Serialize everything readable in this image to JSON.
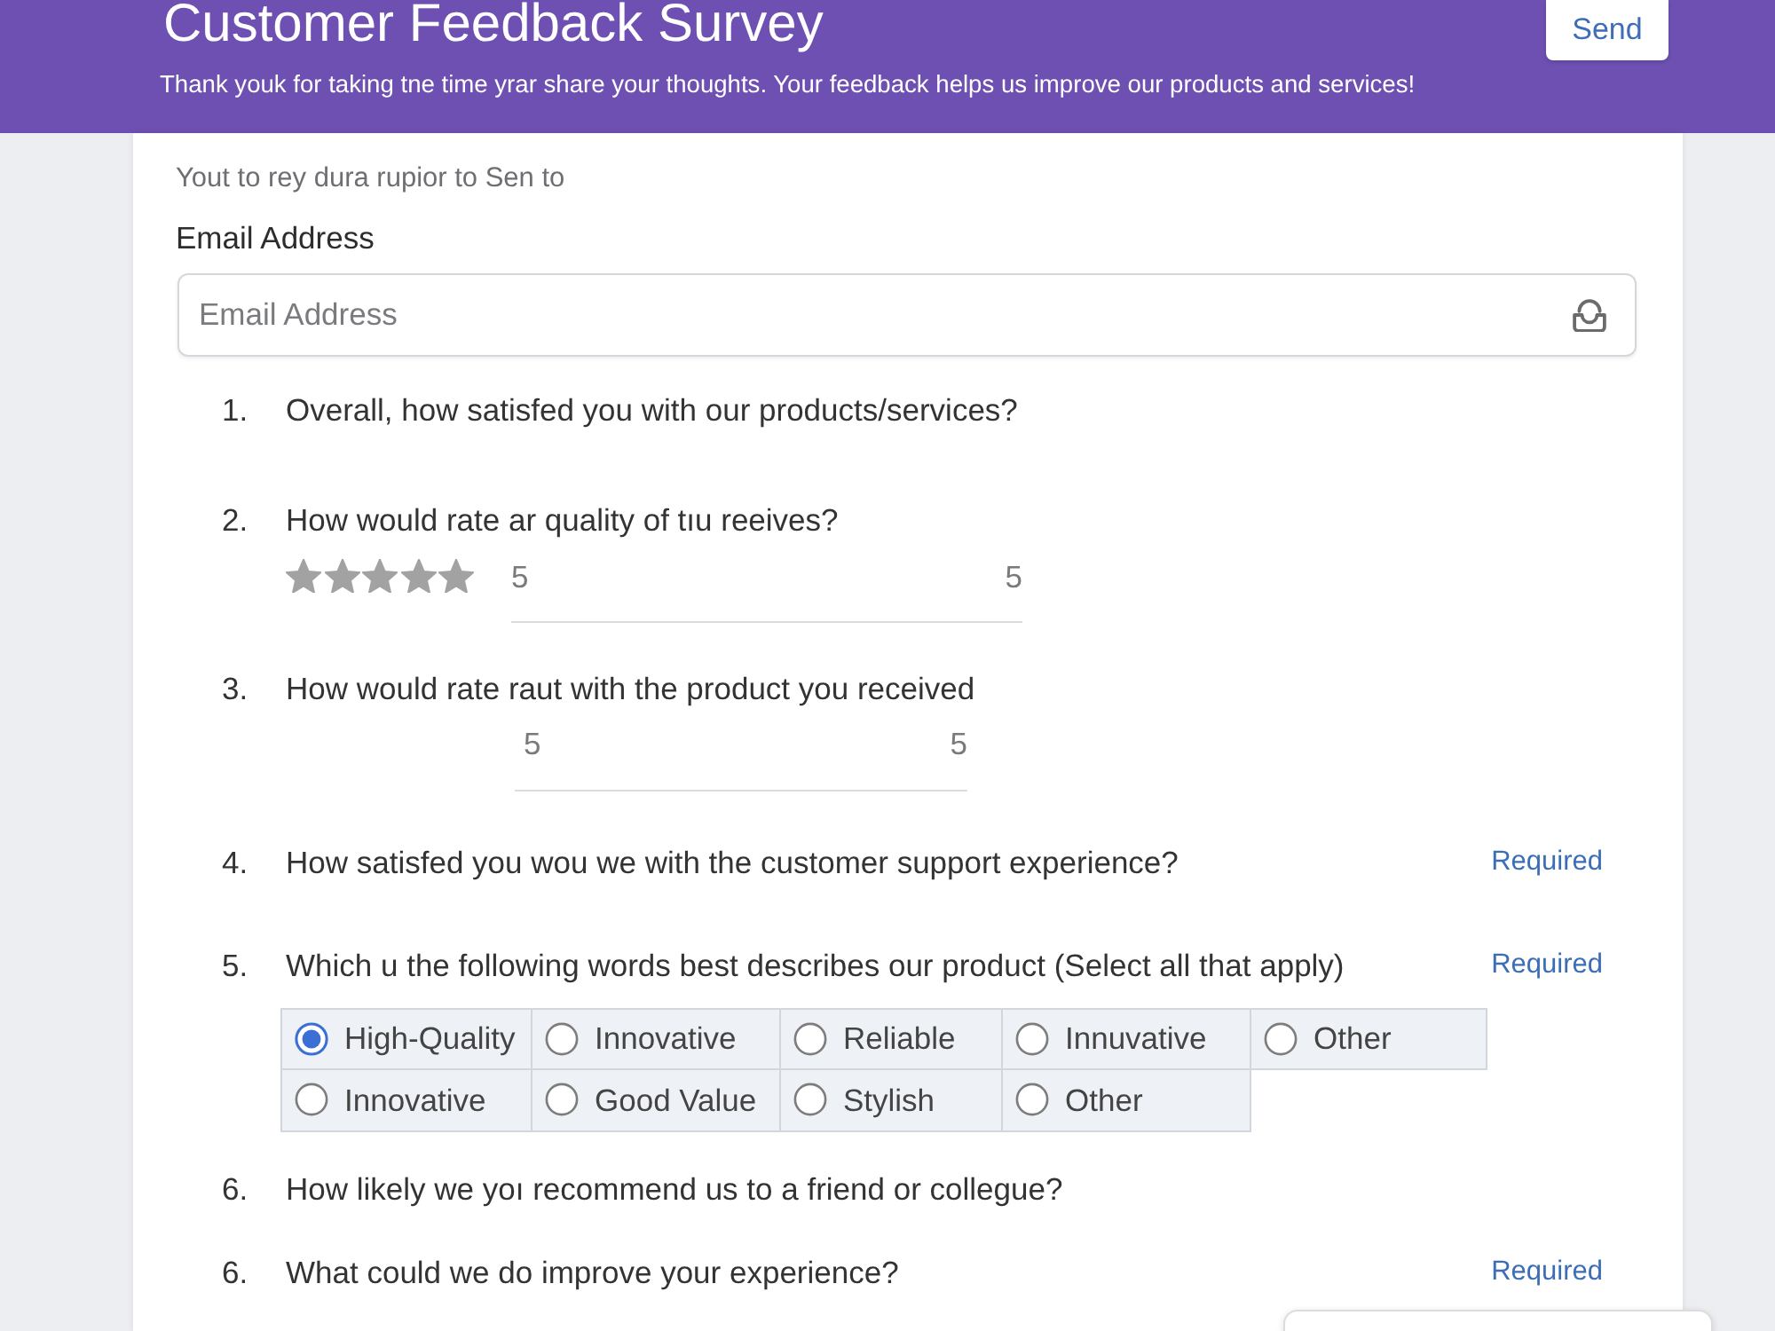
{
  "header": {
    "title": "Customer Feedback Survey",
    "subtitle": "Thank youk for taking tne time yrar share your thoughts. Your feedback helps us improve our products and services!",
    "send_button": "Send"
  },
  "form": {
    "note": "Yout to rey dura rupior to Sen to",
    "email": {
      "label": "Email Address",
      "placeholder": "Email Address"
    },
    "questions": [
      {
        "number": "1.",
        "text": "Overall, how satisfed you with our products/services?",
        "kind": "plain"
      },
      {
        "number": "2.",
        "text": "How would rate ar quality of tıu reeives?",
        "kind": "rating",
        "stars": 5,
        "scale": {
          "low": "5",
          "high": "5"
        }
      },
      {
        "number": "3.",
        "text": "How would rate raut with the product you received",
        "kind": "scale",
        "scale": {
          "low": "5",
          "high": "5"
        }
      },
      {
        "number": "4.",
        "text": "How satisfed you wou we with the customer support experience?",
        "kind": "plain",
        "badge": "Required"
      },
      {
        "number": "5.",
        "text": "Which u the following words best describes our product (Select all that apply)",
        "kind": "choice",
        "badge": "Required",
        "options": [
          {
            "label": "High-Quality",
            "selected": true
          },
          {
            "label": "Innovative",
            "selected": false
          },
          {
            "label": "Reliable",
            "selected": false
          },
          {
            "label": "Innuvative",
            "selected": false
          },
          {
            "label": "Other",
            "selected": false
          },
          {
            "label": "Innovative",
            "selected": false
          },
          {
            "label": "Good Value",
            "selected": false
          },
          {
            "label": "Stylish",
            "selected": false
          },
          {
            "label": "Other",
            "selected": false
          }
        ]
      },
      {
        "number": "6.",
        "text": "How likely we yoı recommend us to a friend or collegue?",
        "kind": "plain"
      },
      {
        "number": "6.",
        "text": "What could we do improve your experience?",
        "kind": "plain",
        "badge": "Required"
      }
    ]
  }
}
